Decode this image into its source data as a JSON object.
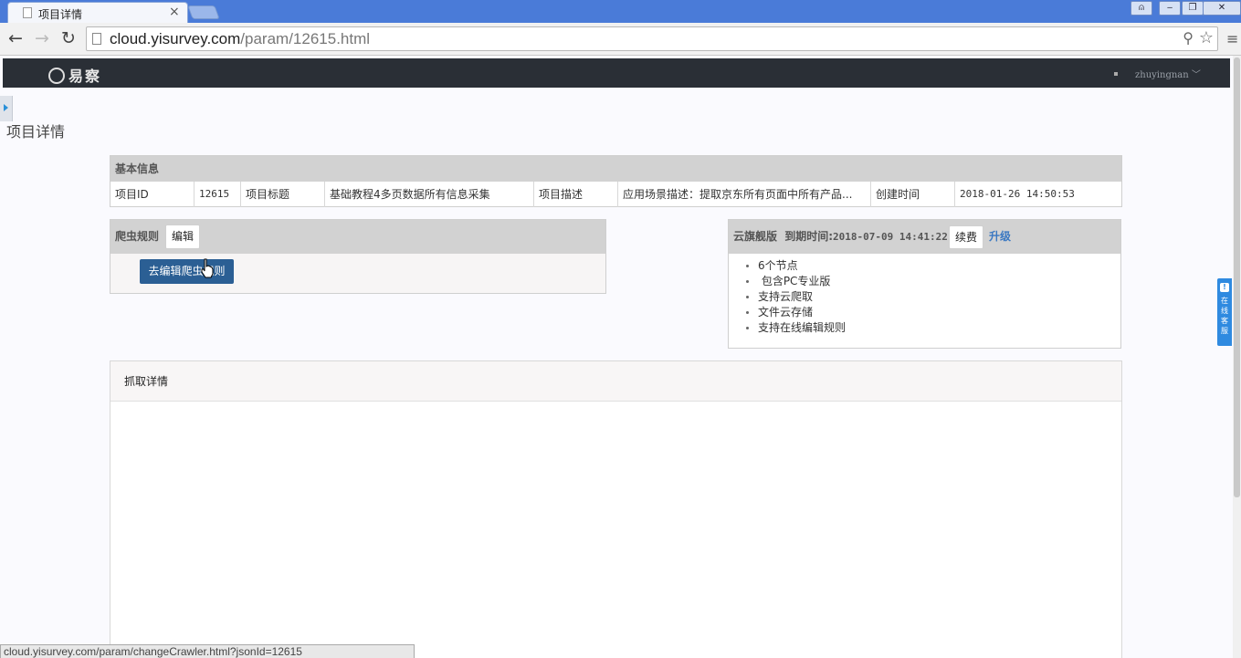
{
  "browser": {
    "tab_title": "项目详情",
    "tab_close": "×",
    "url_host": "cloud.yisurvey.com",
    "url_path": "/param/12615.html",
    "back_glyph": "←",
    "forward_glyph": "→",
    "reload_glyph": "↻",
    "search_glyph": "⚲",
    "star_glyph": "☆",
    "menu_glyph": "≡",
    "min_glyph": "‒",
    "max_glyph": "❐",
    "close_glyph": "✕",
    "user_glyph": "⍝",
    "status_url": "cloud.yisurvey.com/param/changeCrawler.html?jsonId=12615"
  },
  "header": {
    "logo_text": "易察",
    "username": "zhuyingnan",
    "caret": "﹀"
  },
  "page": {
    "title": "项目详情"
  },
  "basic_info": {
    "heading": "基本信息",
    "cells": [
      {
        "text": "项目ID"
      },
      {
        "text": "12615"
      },
      {
        "text": "项目标题"
      },
      {
        "text": "基础教程4多页数据所有信息采集"
      },
      {
        "text": "项目描述"
      },
      {
        "text": "应用场景描述：提取京东所有页面中所有产品..."
      },
      {
        "text": "创建时间"
      },
      {
        "text": "2018-01-26 14:50:53"
      }
    ]
  },
  "crawler_rule": {
    "heading": "爬虫规则",
    "edit_label": "编辑",
    "goto_label": "去编辑爬虫规则"
  },
  "version": {
    "name": "云旗舰版",
    "expire_label": "到期时间:",
    "expire_time": "2018-07-09 14:41:22",
    "renew_label": "续费",
    "upgrade_label": "升级",
    "features": [
      "6个节点",
      " 包含PC专业版",
      "支持云爬取",
      "文件云存储",
      "支持在线编辑规则"
    ]
  },
  "service": {
    "icon": "!",
    "text": "在线客服"
  },
  "detail": {
    "heading": "抓取详情"
  }
}
